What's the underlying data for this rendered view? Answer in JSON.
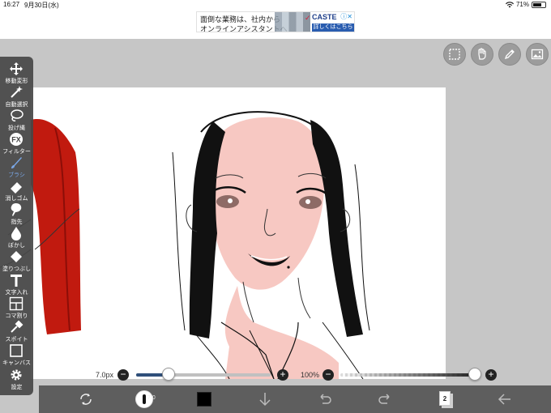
{
  "status_bar": {
    "time": "16:27",
    "date": "9月30日(水)",
    "battery": "71%",
    "battery_level": 0.71
  },
  "ad": {
    "line1": "面倒な業務は、社内から",
    "line2": "オンラインアシスタントへ",
    "brand": "CASTE",
    "cta": "詳しくはこちら",
    "close": "ⓘ✕"
  },
  "toolbar": {
    "items": [
      {
        "label": "移動変形",
        "icon": "move-arrows-icon"
      },
      {
        "label": "自動選択",
        "icon": "magic-wand-icon"
      },
      {
        "label": "投げ縄",
        "icon": "lasso-icon"
      },
      {
        "label": "フィルター",
        "icon": "fx-icon"
      },
      {
        "label": "ブラシ",
        "icon": "brush-icon",
        "active": true
      },
      {
        "label": "消しゴム",
        "icon": "eraser-icon"
      },
      {
        "label": "指先",
        "icon": "finger-smudge-icon"
      },
      {
        "label": "ぼかし",
        "icon": "blur-drop-icon"
      },
      {
        "label": "塗りつぶし",
        "icon": "bucket-fill-icon"
      },
      {
        "label": "文字入れ",
        "icon": "text-T-icon"
      },
      {
        "label": "コマ割り",
        "icon": "panel-divide-icon"
      },
      {
        "label": "スポイト",
        "icon": "eyedropper-icon"
      },
      {
        "label": "キャンバス",
        "icon": "canvas-icon"
      },
      {
        "label": "設定",
        "icon": "gear-icon"
      }
    ]
  },
  "top_tools": [
    "selection-icon",
    "hand-icon",
    "pen-icon",
    "image-icon"
  ],
  "brush": {
    "size_label": "7.0px",
    "size_fraction": 0.24,
    "opacity_label": "100%",
    "opacity_fraction": 1.0,
    "minus": "−",
    "plus": "+"
  },
  "bottom_bar": {
    "brush_size_num": "7.0",
    "layer_count": "2",
    "color": "#000000"
  },
  "colors": {
    "toolbar_bg": "#464646",
    "bottom_bar": "#5e5e5e",
    "canvas": "#ffffff",
    "background": "#c6c6c6",
    "hair_red": "#c11a0f",
    "skin": "#f7c8c2"
  }
}
